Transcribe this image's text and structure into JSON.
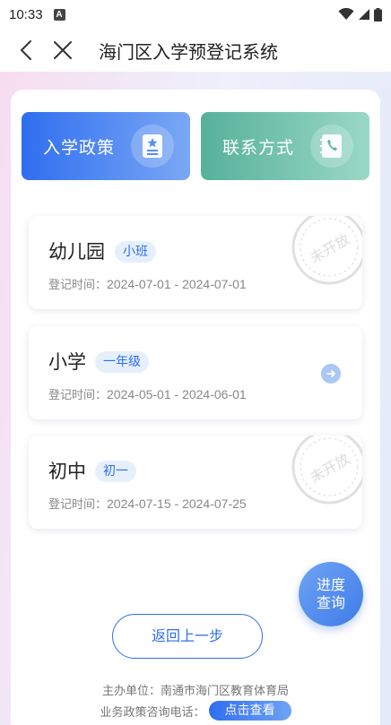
{
  "status_bar": {
    "time": "10:33",
    "notification_badge": "A"
  },
  "nav": {
    "title": "海门区入学预登记系统"
  },
  "top_buttons": {
    "policy_label": "入学政策",
    "contact_label": "联系方式"
  },
  "schools": [
    {
      "name": "幼儿园",
      "grade": "小班",
      "time_label": "登记时间：",
      "time_value": "2024-07-01 - 2024-07-01",
      "status": "未开放"
    },
    {
      "name": "小学",
      "grade": "一年级",
      "time_label": "登记时间：",
      "time_value": "2024-05-01 - 2024-06-01",
      "status": ""
    },
    {
      "name": "初中",
      "grade": "初一",
      "time_label": "登记时间：",
      "time_value": "2024-07-15 - 2024-07-25",
      "status": "未开放"
    }
  ],
  "progress_query": {
    "line1": "进度",
    "line2": "查询"
  },
  "back_step_label": "返回上一步",
  "footer": {
    "organizer": "主办单位：南通市海门区教育体育局",
    "phone_label": "业务政策咨询电话：",
    "view_label": "点击查看"
  },
  "colors": {
    "primary_blue": "#2f6ef0",
    "contact_green": "#56b19a",
    "tag_bg": "#e6f0fd"
  }
}
